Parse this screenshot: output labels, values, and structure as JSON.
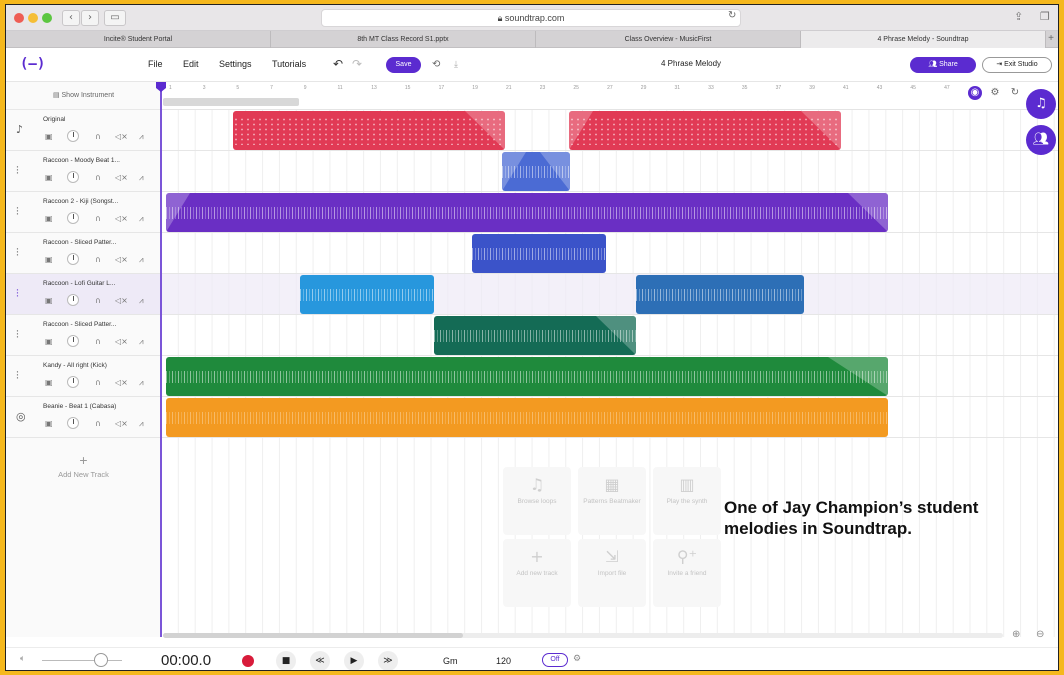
{
  "browser": {
    "url": "soundtrap.com",
    "tabs": [
      {
        "label": "Incite® Student Portal"
      },
      {
        "label": "8th MT Class Record S1.pptx"
      },
      {
        "label": "Class Overview - MusicFirst"
      },
      {
        "label": "4 Phrase Melody - Soundtrap"
      }
    ]
  },
  "app": {
    "logo": "(—)",
    "menu": {
      "file": "File",
      "edit": "Edit",
      "settings": "Settings",
      "tutorials": "Tutorials"
    },
    "save_label": "Save",
    "project_title": "4 Phrase Melody",
    "share_label": "Share",
    "exit_label": "Exit Studio"
  },
  "left_panel": {
    "show_instrument": "Show Instrument",
    "add_track": "Add New Track",
    "tracks": [
      {
        "name": "Original",
        "icon": "guitar-icon"
      },
      {
        "name": "Raccoon - Moody Beat 1...",
        "icon": "waveform-icon"
      },
      {
        "name": "Raccoon 2 - Kiji (Songst...",
        "icon": "waveform-icon"
      },
      {
        "name": "Raccoon - Sliced Patter...",
        "icon": "waveform-icon"
      },
      {
        "name": "Raccoon - Lofi Guitar L...",
        "icon": "waveform-icon"
      },
      {
        "name": "Raccoon - Sliced Patter...",
        "icon": "waveform-icon"
      },
      {
        "name": "Kandy - All right (Kick)",
        "icon": "waveform-icon"
      },
      {
        "name": "Beanie - Beat 1 (Cabasa)",
        "icon": "drum-icon"
      }
    ]
  },
  "ruler": {
    "marks": [
      "1",
      "3",
      "5",
      "7",
      "9",
      "11",
      "13",
      "15",
      "17",
      "19",
      "21",
      "23",
      "25",
      "27",
      "29",
      "31",
      "33",
      "35",
      "37",
      "39",
      "41",
      "43",
      "45",
      "47"
    ]
  },
  "empty_tiles": [
    {
      "label": "Browse loops"
    },
    {
      "label": "Patterns Beatmaker"
    },
    {
      "label": "Play the synth"
    },
    {
      "label": "Add new track"
    },
    {
      "label": "Import file"
    },
    {
      "label": "Invite a friend"
    }
  ],
  "caption": "One of Jay Champion’s student melodies in Soundtrap.",
  "transport": {
    "time": "00:00.0",
    "key": "Gm",
    "bpm": "120",
    "metronome": "Off"
  },
  "colors": {
    "accent": "#5b2bd0",
    "red": "#e13a55",
    "blue": "#4b6bd4",
    "purple": "#6a2fc4",
    "indigo": "#3b53c9",
    "skyblue": "#2797dd",
    "steelblue": "#2d6fb6",
    "darkgreen": "#146b55",
    "green": "#1f8a3c",
    "orange": "#f39a21"
  }
}
